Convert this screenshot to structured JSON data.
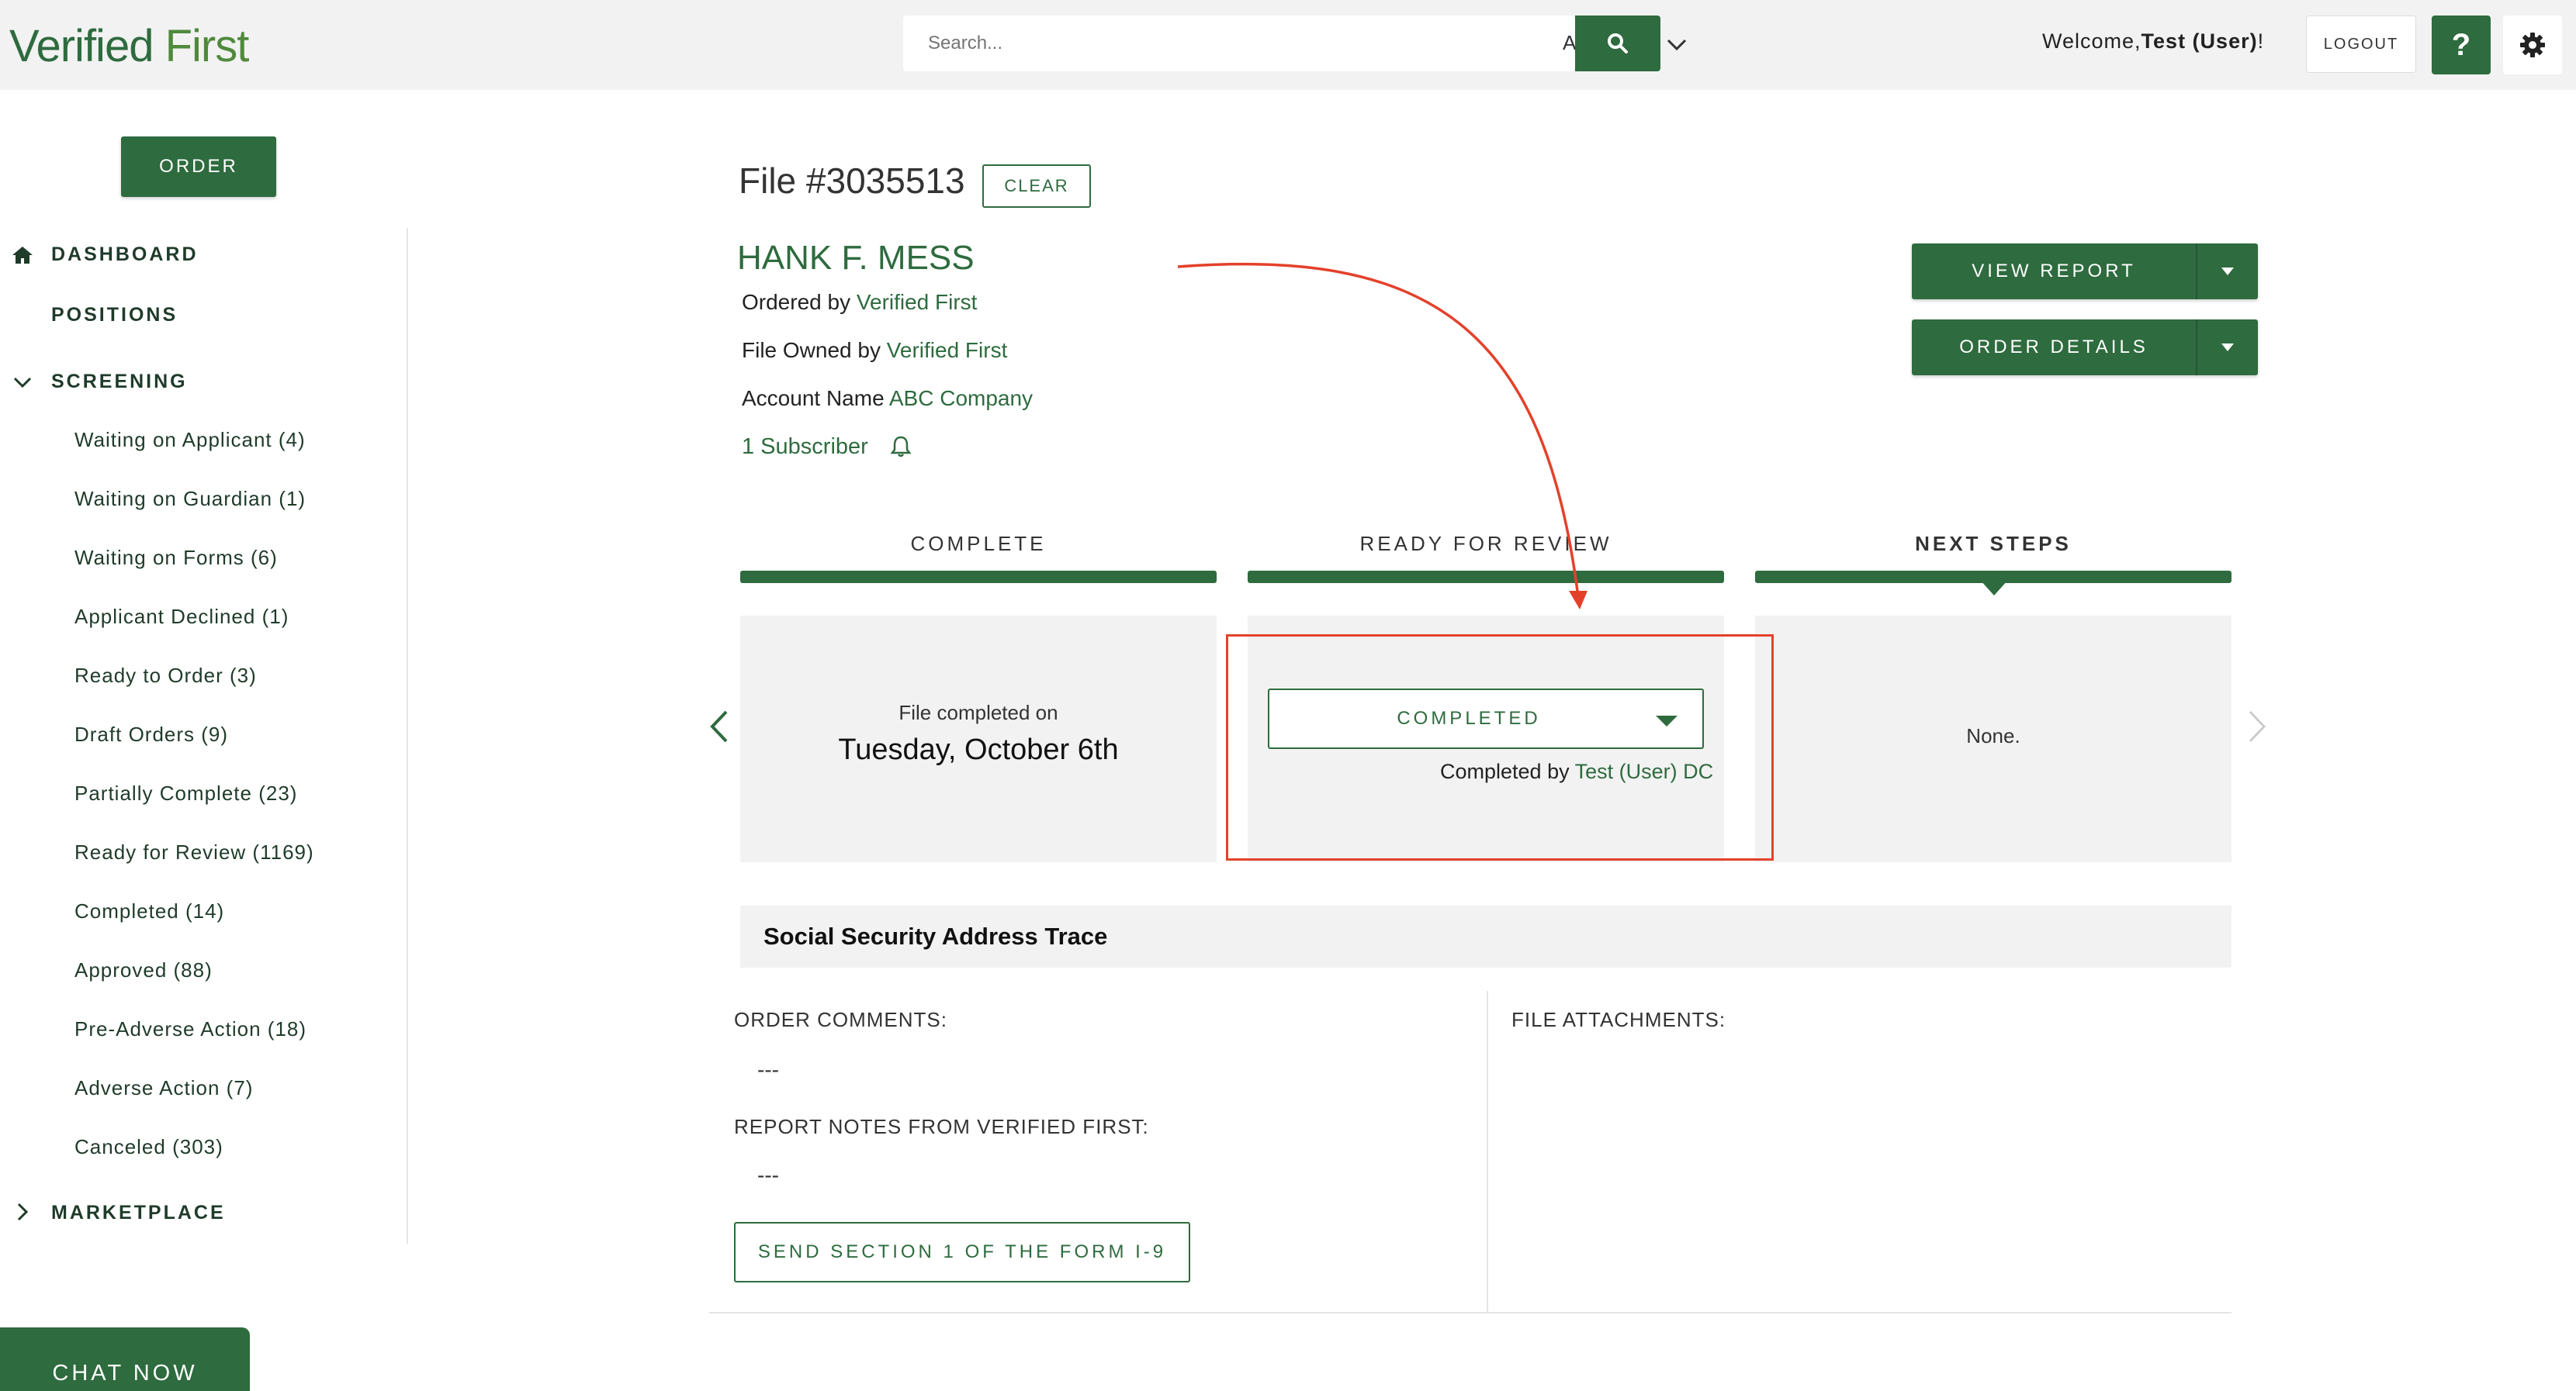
{
  "header": {
    "logo_part1": "Verified",
    "logo_part2": "First",
    "search_placeholder": "Search...",
    "search_scope": "All",
    "welcome_prefix": "Welcome,",
    "welcome_user": "Test (User)",
    "welcome_suffix": "!",
    "logout_label": "LOGOUT",
    "help_label": "?"
  },
  "sidebar": {
    "order_label": "ORDER",
    "dashboard": "DASHBOARD",
    "positions": "POSITIONS",
    "screening": "SCREENING",
    "screening_items": [
      "Waiting on Applicant (4)",
      "Waiting on Guardian (1)",
      "Waiting on Forms (6)",
      "Applicant Declined (1)",
      "Ready to Order (3)",
      "Draft Orders (9)",
      "Partially Complete (23)",
      "Ready for Review (1169)",
      "Completed (14)",
      "Approved (88)",
      "Pre-Adverse Action (18)",
      "Adverse Action (7)",
      "Canceled (303)"
    ],
    "marketplace": "MARKETPLACE"
  },
  "file": {
    "title": "File #3035513",
    "clear_label": "CLEAR",
    "applicant_name": "HANK F. MESS",
    "ordered_by_label": "Ordered by",
    "ordered_by_value": "Verified First",
    "owned_by_label": "File Owned by",
    "owned_by_value": "Verified First",
    "account_label": "Account Name",
    "account_value": "ABC Company",
    "subscriber_label": "1 Subscriber",
    "view_report_label": "VIEW REPORT",
    "order_details_label": "ORDER DETAILS"
  },
  "steps": {
    "complete_label": "COMPLETE",
    "review_label": "READY FOR REVIEW",
    "next_label": "NEXT STEPS",
    "completed_on_label": "File completed on",
    "completed_on_date": "Tuesday, October 6th",
    "status_value": "COMPLETED",
    "completed_by_label": "Completed by",
    "completed_by_value": "Test (User) DC",
    "next_steps_value": "None."
  },
  "details": {
    "section_title": "Social Security Address Trace",
    "order_comments_label": "ORDER COMMENTS:",
    "order_comments_value": "---",
    "report_notes_label": "REPORT NOTES FROM VERIFIED FIRST:",
    "report_notes_value": "---",
    "file_attachments_label": "FILE ATTACHMENTS:",
    "i9_button_label": "SEND SECTION 1 OF THE FORM I-9"
  },
  "chat": {
    "label": "CHAT NOW"
  },
  "colors": {
    "brand_green": "#2e6b3e",
    "annotation_red": "#e4412b",
    "panel_gray": "#f2f2f2"
  }
}
